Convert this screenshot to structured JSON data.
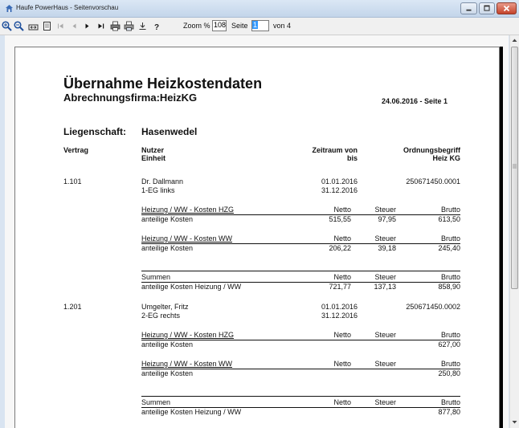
{
  "window": {
    "title": "Haufe PowerHaus - Seitenvorschau"
  },
  "toolbar": {
    "zoom_label": "Zoom %",
    "zoom_value": "108.!",
    "page_label": "Seite",
    "page_value": "1",
    "of_label": "von 4"
  },
  "report": {
    "title": "Übernahme Heizkostendaten",
    "company": "Abrechnungsfirma:HeizKG",
    "date_page": "24.06.2016 - Seite 1",
    "property_label": "Liegenschaft:",
    "property_value": "Hasenwedel",
    "headers": {
      "vertrag": "Vertrag",
      "nutzer": "Nutzer",
      "einheit": "Einheit",
      "zeitraum_von": "Zeitraum von",
      "zeitraum_bis": "bis",
      "ordnung1": "Ordnungsbegriff",
      "ordnung2": "Heiz KG"
    },
    "col": {
      "netto": "Netto",
      "steuer": "Steuer",
      "brutto": "Brutto"
    },
    "contracts": [
      {
        "vertrag": "1.101",
        "nutzer": "Dr. Dallmann",
        "einheit": "1-EG links",
        "von": "01.01.2016",
        "bis": "31.12.2016",
        "ordnung": "250671450.0001",
        "blocks": [
          {
            "title": "Heizung / WW - Kosten HZG",
            "row_label": "anteilige Kosten",
            "netto": "515,55",
            "steuer": "97,95",
            "brutto": "613,50"
          },
          {
            "title": "Heizung / WW - Kosten WW",
            "row_label": "anteilige Kosten",
            "netto": "206,22",
            "steuer": "39,18",
            "brutto": "245,40"
          }
        ],
        "sum": {
          "title": "Summen",
          "row_label": "anteilige Kosten Heizung / WW",
          "netto": "721,77",
          "steuer": "137,13",
          "brutto": "858,90"
        }
      },
      {
        "vertrag": "1.201",
        "nutzer": "Umgelter,  Fritz",
        "einheit": "2-EG rechts",
        "von": "01.01.2016",
        "bis": "31.12.2016",
        "ordnung": "250671450.0002",
        "blocks": [
          {
            "title": "Heizung / WW - Kosten HZG",
            "row_label": "anteilige Kosten",
            "netto": "",
            "steuer": "",
            "brutto": "627,00"
          },
          {
            "title": "Heizung / WW - Kosten WW",
            "row_label": "anteilige Kosten",
            "netto": "",
            "steuer": "",
            "brutto": "250,80"
          }
        ],
        "sum": {
          "title": "Summen",
          "row_label": "anteilige Kosten Heizung / WW",
          "netto": "",
          "steuer": "",
          "brutto": "877,80"
        }
      }
    ]
  }
}
